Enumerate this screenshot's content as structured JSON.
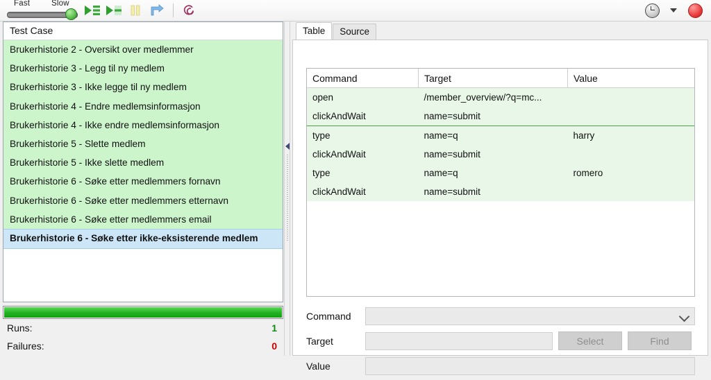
{
  "toolbar": {
    "speed_fast_label": "Fast",
    "speed_slow_label": "Slow",
    "speed_value": "Slow",
    "buttons": [
      {
        "name": "play-entire-suite-button",
        "icon": "play-all-icon",
        "title": "Play entire test suite"
      },
      {
        "name": "play-current-test-button",
        "icon": "play-current-icon",
        "title": "Play current test case"
      },
      {
        "name": "pause-button",
        "icon": "pause-icon",
        "title": "Pause"
      },
      {
        "name": "step-button",
        "icon": "step-icon",
        "title": "Step"
      },
      {
        "name": "selenium-logo",
        "icon": "selenium-logo-icon",
        "title": "Selenium IDE"
      }
    ],
    "clock_icon": "clock-icon",
    "dropdown_icon": "chevron-down-icon",
    "record_icon": "record-button-icon"
  },
  "left_panel": {
    "header": "Test Case",
    "test_cases": [
      {
        "label": "Brukerhistorie 2 - Oversikt over medlemmer",
        "selected": false
      },
      {
        "label": "Brukerhistorie 3 - Legg til ny medlem",
        "selected": false
      },
      {
        "label": "Brukerhistorie 3 - Ikke legge til ny medlem",
        "selected": false
      },
      {
        "label": "Brukerhistorie 4 - Endre medlemsinformasjon",
        "selected": false
      },
      {
        "label": "Brukerhistorie 4 - Ikke endre medlemsinformasjon",
        "selected": false
      },
      {
        "label": "Brukerhistorie 5 - Slette medlem",
        "selected": false
      },
      {
        "label": "Brukerhistorie 5 - Ikke slette medlem",
        "selected": false
      },
      {
        "label": "Brukerhistorie 6 - Søke etter medlemmers fornavn",
        "selected": false
      },
      {
        "label": "Brukerhistorie 6 - Søke etter medlemmers etternavn",
        "selected": false
      },
      {
        "label": "Brukerhistorie 6 - Søke etter medlemmers email",
        "selected": false
      },
      {
        "label": "Brukerhistorie 6 - Søke etter ikke-eksisterende medlem",
        "selected": true
      }
    ],
    "progress_percent": 100,
    "progress_color": "#24b324",
    "stats": [
      {
        "label": "Runs:",
        "value": "1",
        "color": "#118811"
      },
      {
        "label": "Failures:",
        "value": "0",
        "color": "#cc0000"
      }
    ]
  },
  "right_panel": {
    "tabs": [
      {
        "label": "Table",
        "active": true
      },
      {
        "label": "Source",
        "active": false
      }
    ],
    "table": {
      "columns": [
        "Command",
        "Target",
        "Value"
      ],
      "rows": [
        {
          "command": "open",
          "target": "/member_overview/?q=mc...",
          "value": "",
          "group_end": false
        },
        {
          "command": "clickAndWait",
          "target": "name=submit",
          "value": "",
          "group_end": true
        },
        {
          "command": "type",
          "target": "name=q",
          "value": "harry",
          "group_end": false
        },
        {
          "command": "clickAndWait",
          "target": "name=submit",
          "value": "",
          "group_end": false
        },
        {
          "command": "type",
          "target": "name=q",
          "value": "romero",
          "group_end": false
        },
        {
          "command": "clickAndWait",
          "target": "name=submit",
          "value": "",
          "group_end": false
        }
      ]
    },
    "form": {
      "command_label": "Command",
      "command_value": "",
      "target_label": "Target",
      "target_value": "",
      "value_label": "Value",
      "value_value": "",
      "select_button": "Select",
      "find_button": "Find"
    }
  }
}
